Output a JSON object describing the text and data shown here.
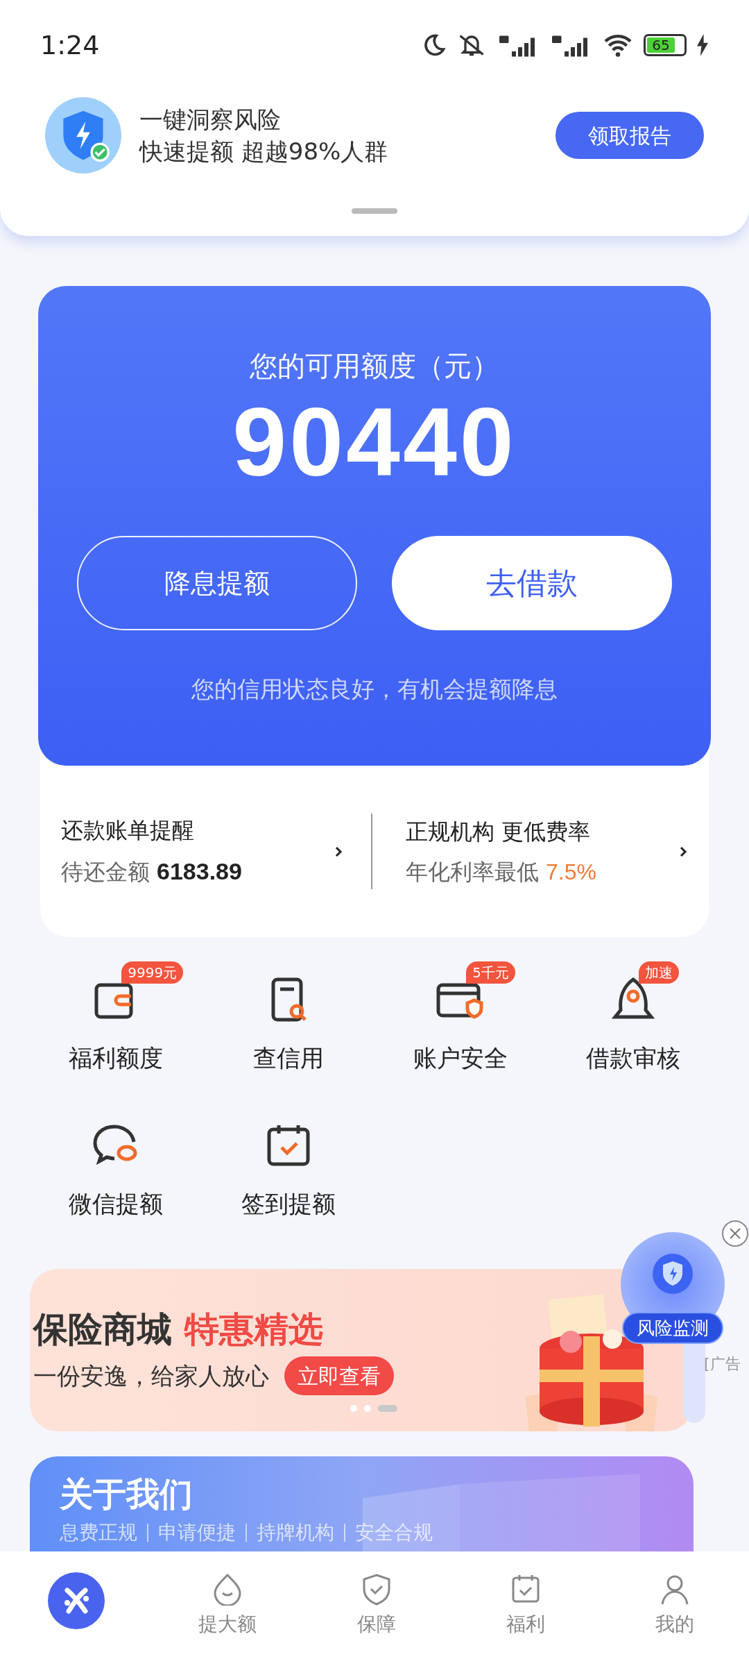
{
  "status_bar": {
    "time": "1:24",
    "battery": "65"
  },
  "notice": {
    "title": "一键洞察风险",
    "subtitle": "快速提额 超越98%人群",
    "button": "领取报告"
  },
  "credit": {
    "title": "您的可用额度（元）",
    "amount": "90440",
    "note": "您的信用状态良好，有机会提额降息",
    "buttons": [
      {
        "label": "降息提额",
        "kind": "outline"
      },
      {
        "label": "去借款",
        "kind": "solid"
      }
    ]
  },
  "info_cards": [
    {
      "title": "还款账单提醒",
      "label": "待还金额",
      "value": "6183.89",
      "kind": "amount"
    },
    {
      "title": "正规机构 更低费率",
      "label": "年化利率最低",
      "value": "7.5%",
      "kind": "rate"
    }
  ],
  "shortcuts": [
    {
      "label": "福利额度",
      "badge": "9999元",
      "kind": "wallet"
    },
    {
      "label": "查信用",
      "kind": "doc"
    },
    {
      "label": "账户安全",
      "badge": "5千元",
      "kind": "card"
    },
    {
      "label": "借款审核",
      "badge": "加速",
      "kind": "rocket"
    },
    {
      "label": "微信提额",
      "kind": "chat"
    },
    {
      "label": "签到提额",
      "kind": "calendar"
    }
  ],
  "promo": {
    "title": "保险商城",
    "highlight": "特惠精选",
    "subtitle": "一份安逸，给家人放心",
    "button": "立即查看",
    "dots": [
      {
        "selected": false
      },
      {
        "selected": false
      },
      {
        "selected": true
      }
    ]
  },
  "float_ad": {
    "label": "风险监测",
    "ad_tag": "[广告"
  },
  "about": {
    "title": "关于我们",
    "tags": [
      "息费正规",
      "申请便捷",
      "持牌机构",
      "安全合规"
    ]
  },
  "nav": [
    {
      "kind": "home",
      "selected": true
    },
    {
      "kind": "drop",
      "label": "提大额",
      "selected": false
    },
    {
      "kind": "shield",
      "label": "保障",
      "selected": false
    },
    {
      "kind": "calendar",
      "label": "福利",
      "selected": false
    },
    {
      "kind": "person",
      "label": "我的",
      "selected": false
    }
  ]
}
